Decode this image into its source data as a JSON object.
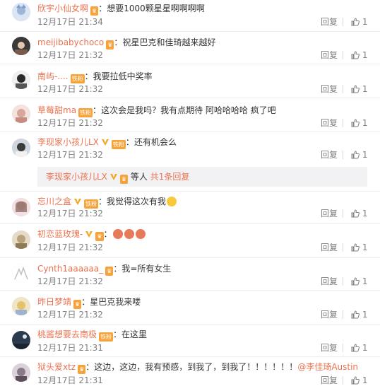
{
  "comments": [
    {
      "user": "欣宇小仙女啊",
      "sep": "：",
      "text": "想要1000颗星星啊啊啊啊",
      "time": "12月17日 21:34",
      "reply": "回复",
      "likes": "1",
      "fan_badge": "",
      "vip": false
    },
    {
      "user": "meijibabychoco",
      "sep": "：",
      "text": "祝星巴克和佳琦越来越好",
      "time": "12月17日 21:32",
      "reply": "回复",
      "likes": "1",
      "fan_badge": "",
      "vip": false
    },
    {
      "user": "南屿-....",
      "sep": "：",
      "text": "我要拉低中奖率",
      "time": "12月17日 21:32",
      "reply": "回复",
      "likes": "1",
      "fan_badge": "铁粉",
      "vip": false
    },
    {
      "user": "草莓甜ma",
      "sep": "：",
      "text": "这次会是我吗？我有点期待 阿哈哈哈哈 疯了吧",
      "time": "12月17日 21:32",
      "reply": "回复",
      "likes": "1",
      "fan_badge": "铁粉",
      "vip": false
    },
    {
      "user": "李现家小孩儿LX",
      "sep": "：",
      "text": "还有机会么",
      "time": "12月17日 21:32",
      "reply": "回复",
      "likes": "1",
      "fan_badge": "铁粉",
      "vip": true
    },
    {
      "user": "忘川之盒",
      "sep": "：",
      "text": "我觉得这次有我",
      "time": "12月17日 21:32",
      "reply": "回复",
      "likes": "1",
      "fan_badge": "铁粉",
      "vip": true
    },
    {
      "user": "初恋蓝玫瑰-",
      "sep": "：",
      "text": "",
      "time": "12月17日 21:32",
      "reply": "回复",
      "likes": "1",
      "fan_badge": "",
      "vip": true
    },
    {
      "user": "Cynth1aaaaaa_",
      "sep": "：",
      "text": "我=所有女生",
      "time": "12月17日 21:32",
      "reply": "回复",
      "likes": "1",
      "fan_badge": "",
      "vip": false
    },
    {
      "user": "昨日梦靖",
      "sep": "：",
      "text": "星巴克我来喽",
      "time": "12月17日 21:32",
      "reply": "回复",
      "likes": "1",
      "fan_badge": "",
      "vip": false
    },
    {
      "user": "桃酱想要去南极",
      "sep": "：",
      "text": "在这里",
      "time": "12月17日 21:31",
      "reply": "回复",
      "likes": "1",
      "fan_badge": "铁粉",
      "vip": false
    },
    {
      "user": "狱头爱xtz",
      "sep": "：",
      "text": "这边，这边，我有预感，到我了，到我了！！！！！！",
      "at": "@李佳琦Austin",
      "time": "12月17日 21:31",
      "reply": "回复",
      "likes": "1",
      "fan_badge": "",
      "vip": false
    }
  ],
  "subreply": {
    "user": "李现家小孩儿LX",
    "mid": "等人",
    "link": "共1条回复"
  },
  "colors": {
    "accent": "#eb7350",
    "muted": "#808080",
    "badge": "#f7a33a"
  }
}
